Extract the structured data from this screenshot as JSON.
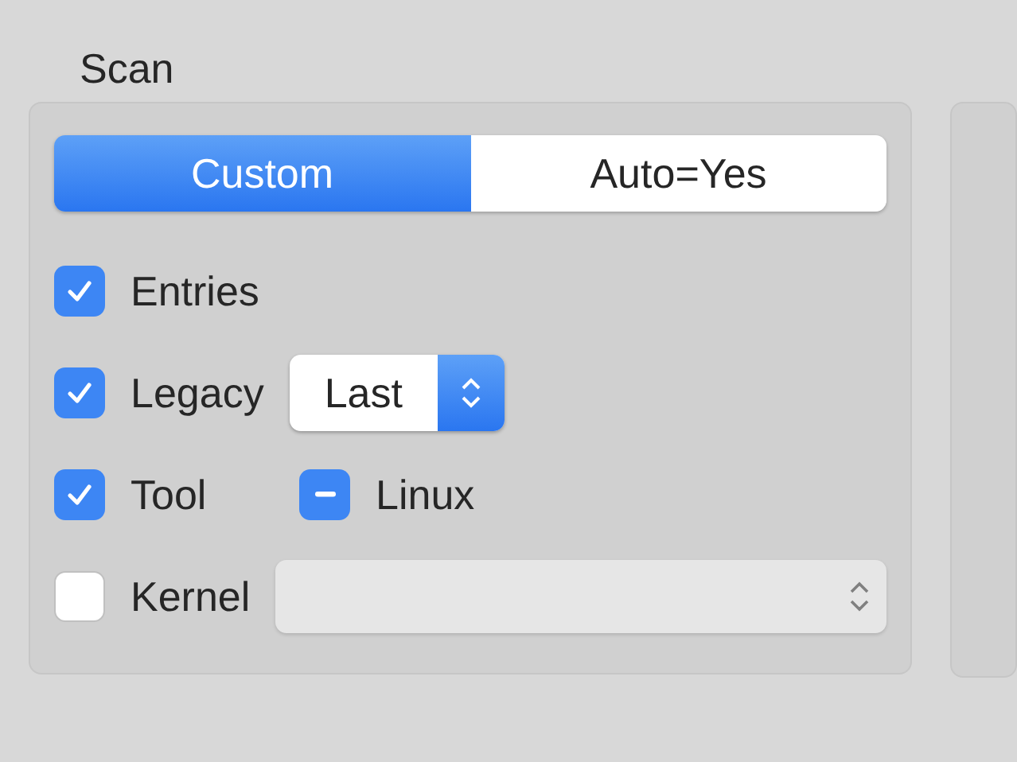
{
  "group": {
    "title": "Scan",
    "segments": [
      {
        "label": "Custom",
        "selected": true
      },
      {
        "label": "Auto=Yes",
        "selected": false
      }
    ],
    "options": [
      {
        "kind": "checkbox",
        "label": "Entries",
        "checked": true
      },
      {
        "kind": "popup",
        "label": "Legacy",
        "checked": true,
        "popup": {
          "value": "Last",
          "disabled": false
        }
      },
      {
        "kind": "sub",
        "label": "Tool",
        "checked": true,
        "sub_option": {
          "label": "Linux",
          "mixed": true
        }
      },
      {
        "kind": "popup",
        "label": "Kernel",
        "checked": false,
        "popup": {
          "disabled": true
        }
      }
    ]
  }
}
